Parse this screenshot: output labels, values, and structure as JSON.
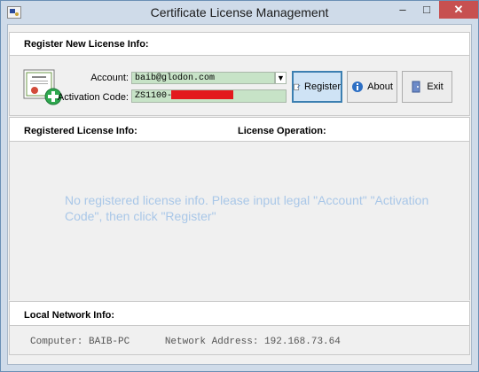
{
  "window": {
    "title": "Certificate License Management",
    "minimize": "–",
    "maximize": "□",
    "close": "✕"
  },
  "register": {
    "heading": "Register New License Info:",
    "account_label": "Account:",
    "account_value": "baib@glodon.com",
    "activation_label": "Activation Code:",
    "activation_value": "ZS1100-",
    "buttons": {
      "register": "Register",
      "about": "About",
      "exit": "Exit"
    }
  },
  "registered": {
    "heading": "Registered License Info:",
    "operation_heading": "License Operation:",
    "empty_message": "No registered license info. Please input legal \"Account\" \"Activation Code\", then click \"Register\""
  },
  "network": {
    "heading": "Local Network Info:",
    "status_line": "Computer: BAIB-PC      Network Address: 192.168.73.64"
  },
  "colors": {
    "field_bg": "#c7e3c7",
    "message": "#a9c7e8",
    "redaction": "#e3191d"
  }
}
